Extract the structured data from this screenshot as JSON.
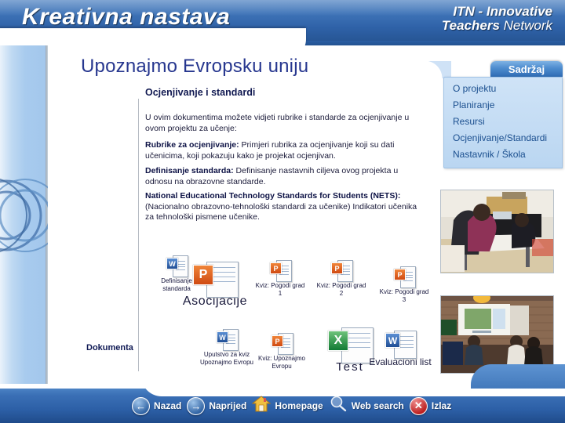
{
  "banner": {
    "brand_left": "Kreativna nastava",
    "brand_right_line1": "ITN - Innovative",
    "brand_right_line2_bold": "Teachers",
    "brand_right_line2_rest": " Network"
  },
  "page": {
    "title": "Upoznajmo Evropsku uniju",
    "section_title": "Ocjenjivanje i standardi",
    "side_label": "Dokumenta"
  },
  "body": {
    "p1": "U ovim dokumentima možete vidjeti rubrike i standarde za ocjenjivanje u ovom projektu za učenje:",
    "p2_bold": "Rubrike za ocjenjivanje:",
    "p2_rest": " Primjeri rubrika za ocjenjivanje koji su dati učenicima, koji pokazuju kako je projekat ocjenjivan.",
    "p3_bold": "Definisanje standarda:",
    "p3_rest": " Definisanje nastavnih ciljeva ovog projekta u odnosu na obrazovne standarde.",
    "p4_bold": "National Educational Technology Standards for Students (NETS):",
    "p4_rest": " (Nacionalno obrazovno-tehnološki standardi za učenike) Indikatori učenika za tehnološki pismene učenike."
  },
  "documents": [
    {
      "caption": "Definisanje\nstandarda",
      "icon": "word-document-icon",
      "badge": "W",
      "size": "small"
    },
    {
      "caption": "Asocijacije",
      "icon": "powerpoint-document-icon",
      "badge": "P",
      "size": "large"
    },
    {
      "caption": "Kviz: Pogodi grad\n1",
      "icon": "powerpoint-document-icon",
      "badge": "P",
      "size": "small"
    },
    {
      "caption": "Kviz: Pogodi grad\n2",
      "icon": "powerpoint-document-icon",
      "badge": "P",
      "size": "small"
    },
    {
      "caption": "Kviz: Pogodi grad\n3",
      "icon": "powerpoint-document-icon",
      "badge": "P",
      "size": "small"
    },
    {
      "caption": "Uputstvo za kviz\nUpoznajmo Evropu",
      "icon": "word-document-icon",
      "badge": "W",
      "size": "small"
    },
    {
      "caption": "Kviz: Upoznajmo\nEvropu",
      "icon": "powerpoint-document-icon",
      "badge": "P",
      "size": "small"
    },
    {
      "caption": "Test",
      "icon": "excel-document-icon",
      "badge": "X",
      "size": "large"
    },
    {
      "caption": "Evaluacioni list",
      "icon": "word-document-icon",
      "badge": "W",
      "size": "medium"
    }
  ],
  "menu": {
    "tab_label": "Sadržaj",
    "items": [
      "O  projektu",
      "Planiranje",
      "Resursi",
      "Ocjenjivanje/Standardi",
      "Nastavnik / Škola"
    ]
  },
  "nav": [
    {
      "label": "Nazad",
      "icon": "back-arrow-icon",
      "glyph": "←",
      "style": "blue"
    },
    {
      "label": "Naprijed",
      "icon": "forward-arrow-icon",
      "glyph": "→",
      "style": "blue"
    },
    {
      "label": "Homepage",
      "icon": "home-icon",
      "glyph": "⌂",
      "style": "house"
    },
    {
      "label": "Web search",
      "icon": "magnifier-icon",
      "glyph": "⚲",
      "style": "glass"
    },
    {
      "label": "Izlaz",
      "icon": "close-x-icon",
      "glyph": "✕",
      "style": "red"
    }
  ],
  "colors": {
    "banner_blue": "#2f62a8",
    "title_navy": "#27378f",
    "stripe_light_blue": "#a8cbee",
    "menu_panel": "#c4dcf4",
    "exit_red": "#b81818"
  },
  "photos": [
    {
      "alt": "students working at table in classroom"
    },
    {
      "alt": "classroom presentation with projector screen"
    }
  ]
}
